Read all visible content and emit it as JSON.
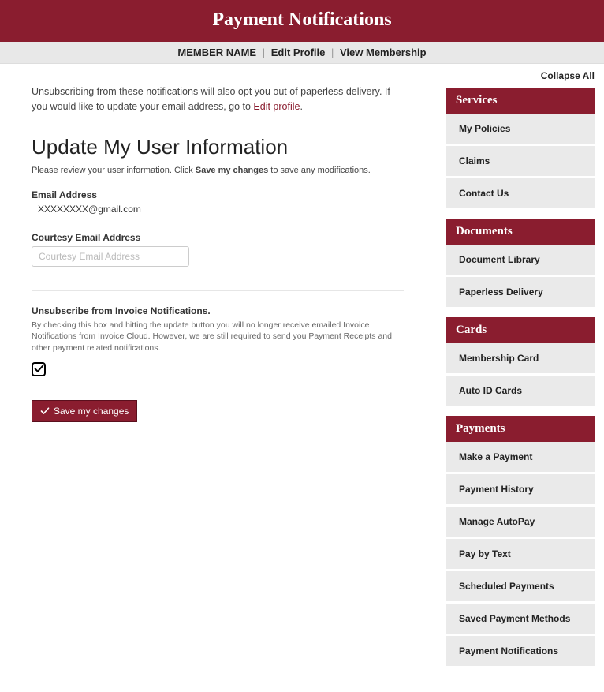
{
  "header": {
    "title": "Payment Notifications"
  },
  "subheader": {
    "member_name": "MEMBER NAME",
    "edit_profile": "Edit Profile",
    "view_membership": "View Membership"
  },
  "intro": {
    "text_a": "Unsubscribing from these notifications will also opt you out of paperless delivery. If you would like to update your email address, go to ",
    "link": "Edit profile",
    "text_b": "."
  },
  "page_heading": "Update My User Information",
  "instruction": {
    "pre": "Please review your user information. Click ",
    "bold": "Save my changes",
    "post": " to save any modifications."
  },
  "email": {
    "label": "Email Address",
    "value": "XXXXXXXX@gmail.com"
  },
  "courtesy": {
    "label": "Courtesy Email Address",
    "placeholder": "Courtesy Email Address",
    "value": ""
  },
  "unsub": {
    "title": "Unsubscribe from Invoice Notifications.",
    "desc": "By checking this box and hitting the update button you will no longer receive emailed Invoice Notifications from Invoice Cloud. However, we are still required to send you Payment Receipts and other payment related notifications.",
    "checked": true
  },
  "save_button": "Save my changes",
  "collapse_all": "Collapse All",
  "sidebar": [
    {
      "header": "Services",
      "items": [
        "My Policies",
        "Claims",
        "Contact Us"
      ]
    },
    {
      "header": "Documents",
      "items": [
        "Document Library",
        "Paperless Delivery"
      ]
    },
    {
      "header": "Cards",
      "items": [
        "Membership Card",
        "Auto ID Cards"
      ]
    },
    {
      "header": "Payments",
      "items": [
        "Make a Payment",
        "Payment History",
        "Manage AutoPay",
        "Pay by Text",
        "Scheduled Payments",
        "Saved Payment Methods",
        "Payment Notifications"
      ]
    }
  ]
}
